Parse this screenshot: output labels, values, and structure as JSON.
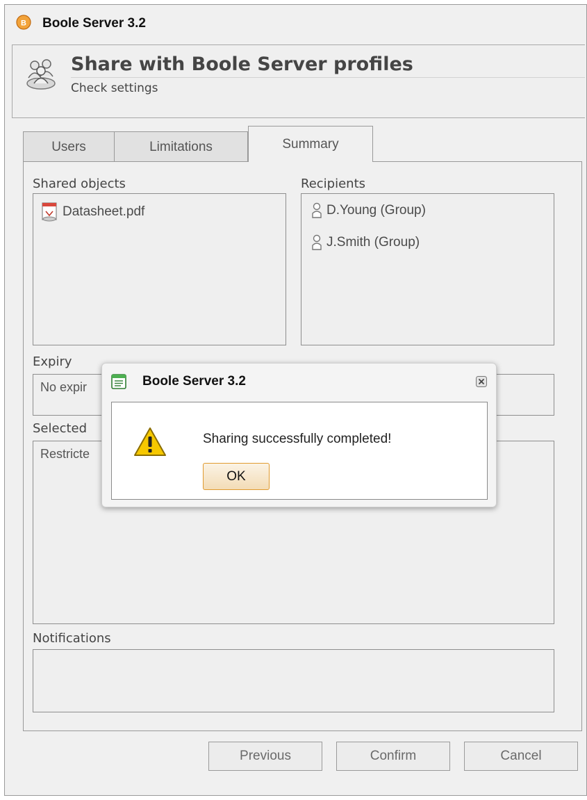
{
  "window": {
    "title": "Boole Server 3.2"
  },
  "header": {
    "title": "Share with Boole Server profiles",
    "subtitle": "Check settings"
  },
  "tabs": [
    {
      "label": "Users",
      "active": false
    },
    {
      "label": "Limitations",
      "active": false
    },
    {
      "label": "Summary",
      "active": true
    }
  ],
  "summary": {
    "shared_objects": {
      "label": "Shared objects",
      "items": [
        "Datasheet.pdf"
      ]
    },
    "recipients": {
      "label": "Recipients",
      "items": [
        "D.Young (Group)",
        "J.Smith (Group)"
      ]
    },
    "expiry": {
      "label": "Expiry",
      "value": "No expir"
    },
    "selected": {
      "label": "Selected",
      "value": "Restricte"
    },
    "notifications": {
      "label": "Notifications",
      "value": ""
    }
  },
  "footer": {
    "previous": "Previous",
    "confirm": "Confirm",
    "cancel": "Cancel"
  },
  "dialog": {
    "title": "Boole Server 3.2",
    "message": "Sharing successfully completed!",
    "ok": "OK",
    "icon": "warning-icon"
  },
  "colors": {
    "accent": "#e09a2e",
    "window_bg": "#f0f0f0",
    "warning": "#f2c200"
  }
}
